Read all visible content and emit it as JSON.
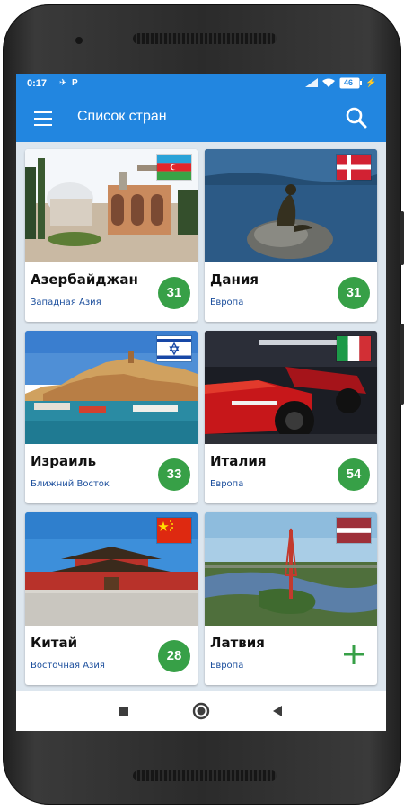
{
  "status_bar": {
    "time": "0:17",
    "battery": "46"
  },
  "app_bar": {
    "title": "Список стран"
  },
  "colors": {
    "primary": "#2286e0",
    "badge": "#37a047",
    "region_text": "#1b4e9c"
  },
  "countries": [
    {
      "name": "Азербайджан",
      "region": "Западная Азия",
      "count": "31",
      "flag": "azerbaijan-flag"
    },
    {
      "name": "Дания",
      "region": "Европа",
      "count": "31",
      "flag": "denmark-flag"
    },
    {
      "name": "Израиль",
      "region": "Ближний Восток",
      "count": "33",
      "flag": "israel-flag"
    },
    {
      "name": "Италия",
      "region": "Европа",
      "count": "54",
      "flag": "italy-flag"
    },
    {
      "name": "Китай",
      "region": "Восточная Азия",
      "count": "28",
      "flag": "china-flag"
    },
    {
      "name": "Латвия",
      "region": "Европа",
      "count": "",
      "action": "add-icon",
      "flag": "latvia-flag"
    }
  ]
}
